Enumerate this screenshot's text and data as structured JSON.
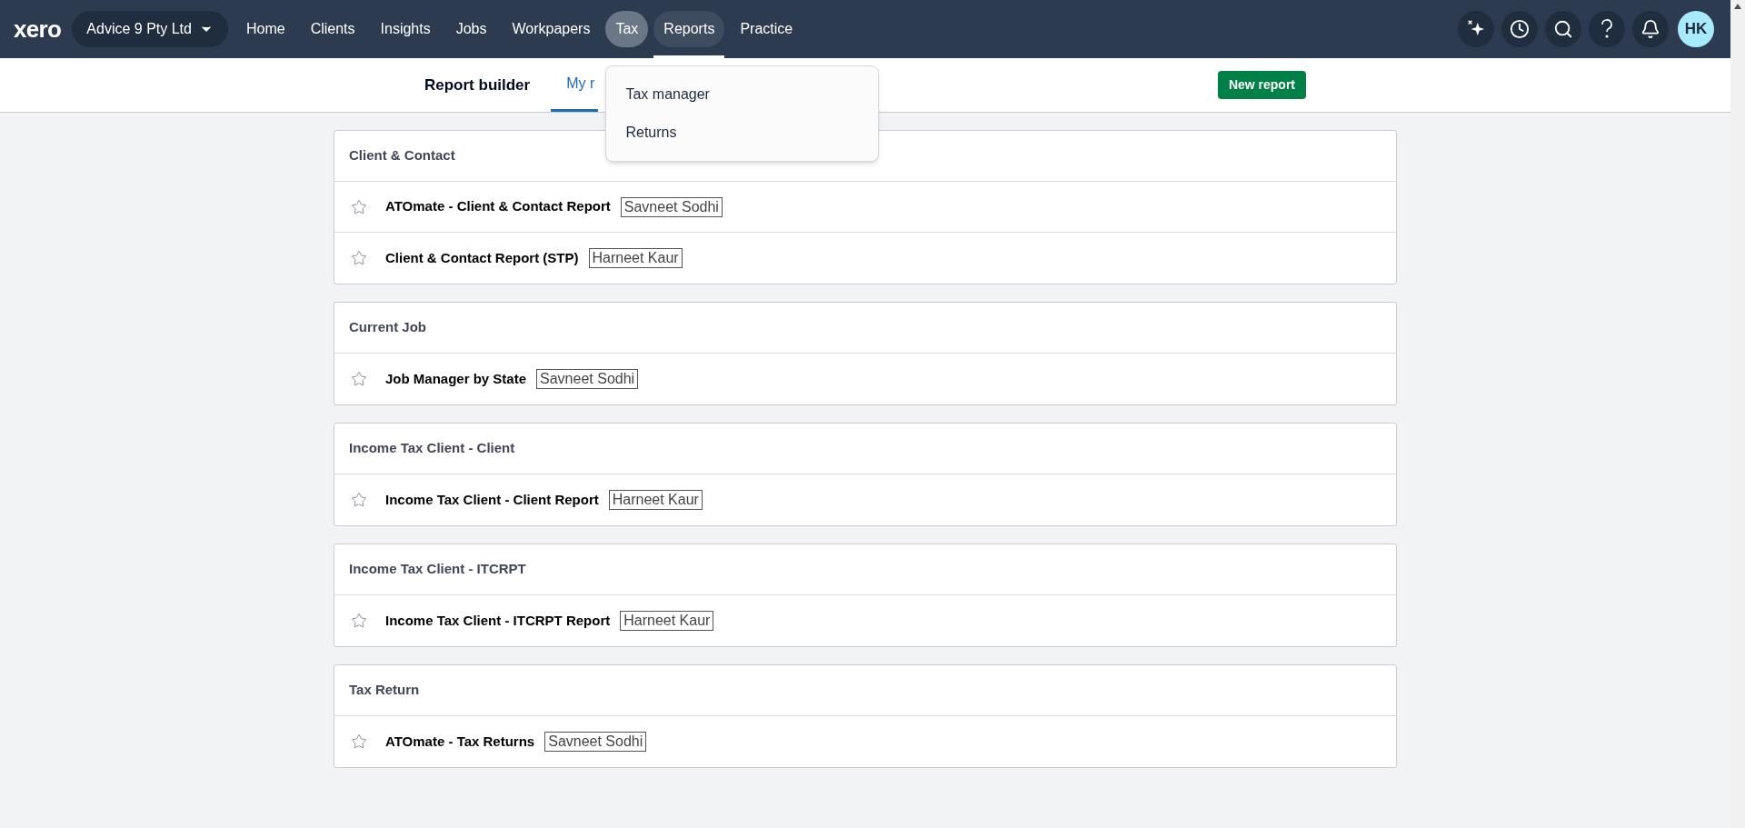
{
  "header": {
    "logo": "xero",
    "organisation": "Advice 9 Pty Ltd",
    "nav": [
      {
        "label": "Home",
        "selected": false,
        "open": false
      },
      {
        "label": "Clients",
        "selected": false,
        "open": false
      },
      {
        "label": "Insights",
        "selected": false,
        "open": false
      },
      {
        "label": "Jobs",
        "selected": false,
        "open": false
      },
      {
        "label": "Workpapers",
        "selected": false,
        "open": false
      },
      {
        "label": "Tax",
        "selected": false,
        "open": true,
        "menu": [
          "Tax manager",
          "Returns"
        ]
      },
      {
        "label": "Reports",
        "selected": true,
        "open": false
      },
      {
        "label": "Practice",
        "selected": false,
        "open": false
      }
    ],
    "avatar": "HK"
  },
  "subheader": {
    "title": "Report builder",
    "tabs": [
      {
        "label": "My r",
        "selected": true
      }
    ],
    "button": "New report"
  },
  "groups": [
    {
      "title": "Client & Contact",
      "reports": [
        {
          "name": "ATOmate - Client & Contact Report",
          "owner": "Savneet Sodhi",
          "starred": false
        },
        {
          "name": "Client & Contact Report (STP)",
          "owner": "Harneet Kaur",
          "starred": false
        }
      ]
    },
    {
      "title": "Current Job",
      "reports": [
        {
          "name": "Job Manager by State",
          "owner": "Savneet Sodhi",
          "starred": false
        }
      ]
    },
    {
      "title": "Income Tax Client - Client",
      "reports": [
        {
          "name": "Income Tax Client - Client Report",
          "owner": "Harneet Kaur",
          "starred": false
        }
      ]
    },
    {
      "title": "Income Tax Client - ITCRPT",
      "reports": [
        {
          "name": "Income Tax Client - ITCRPT Report",
          "owner": "Harneet Kaur",
          "starred": false
        }
      ]
    },
    {
      "title": "Tax Return",
      "reports": [
        {
          "name": "ATOmate - Tax Returns",
          "owner": "Savneet Sodhi",
          "starred": false
        }
      ]
    }
  ]
}
